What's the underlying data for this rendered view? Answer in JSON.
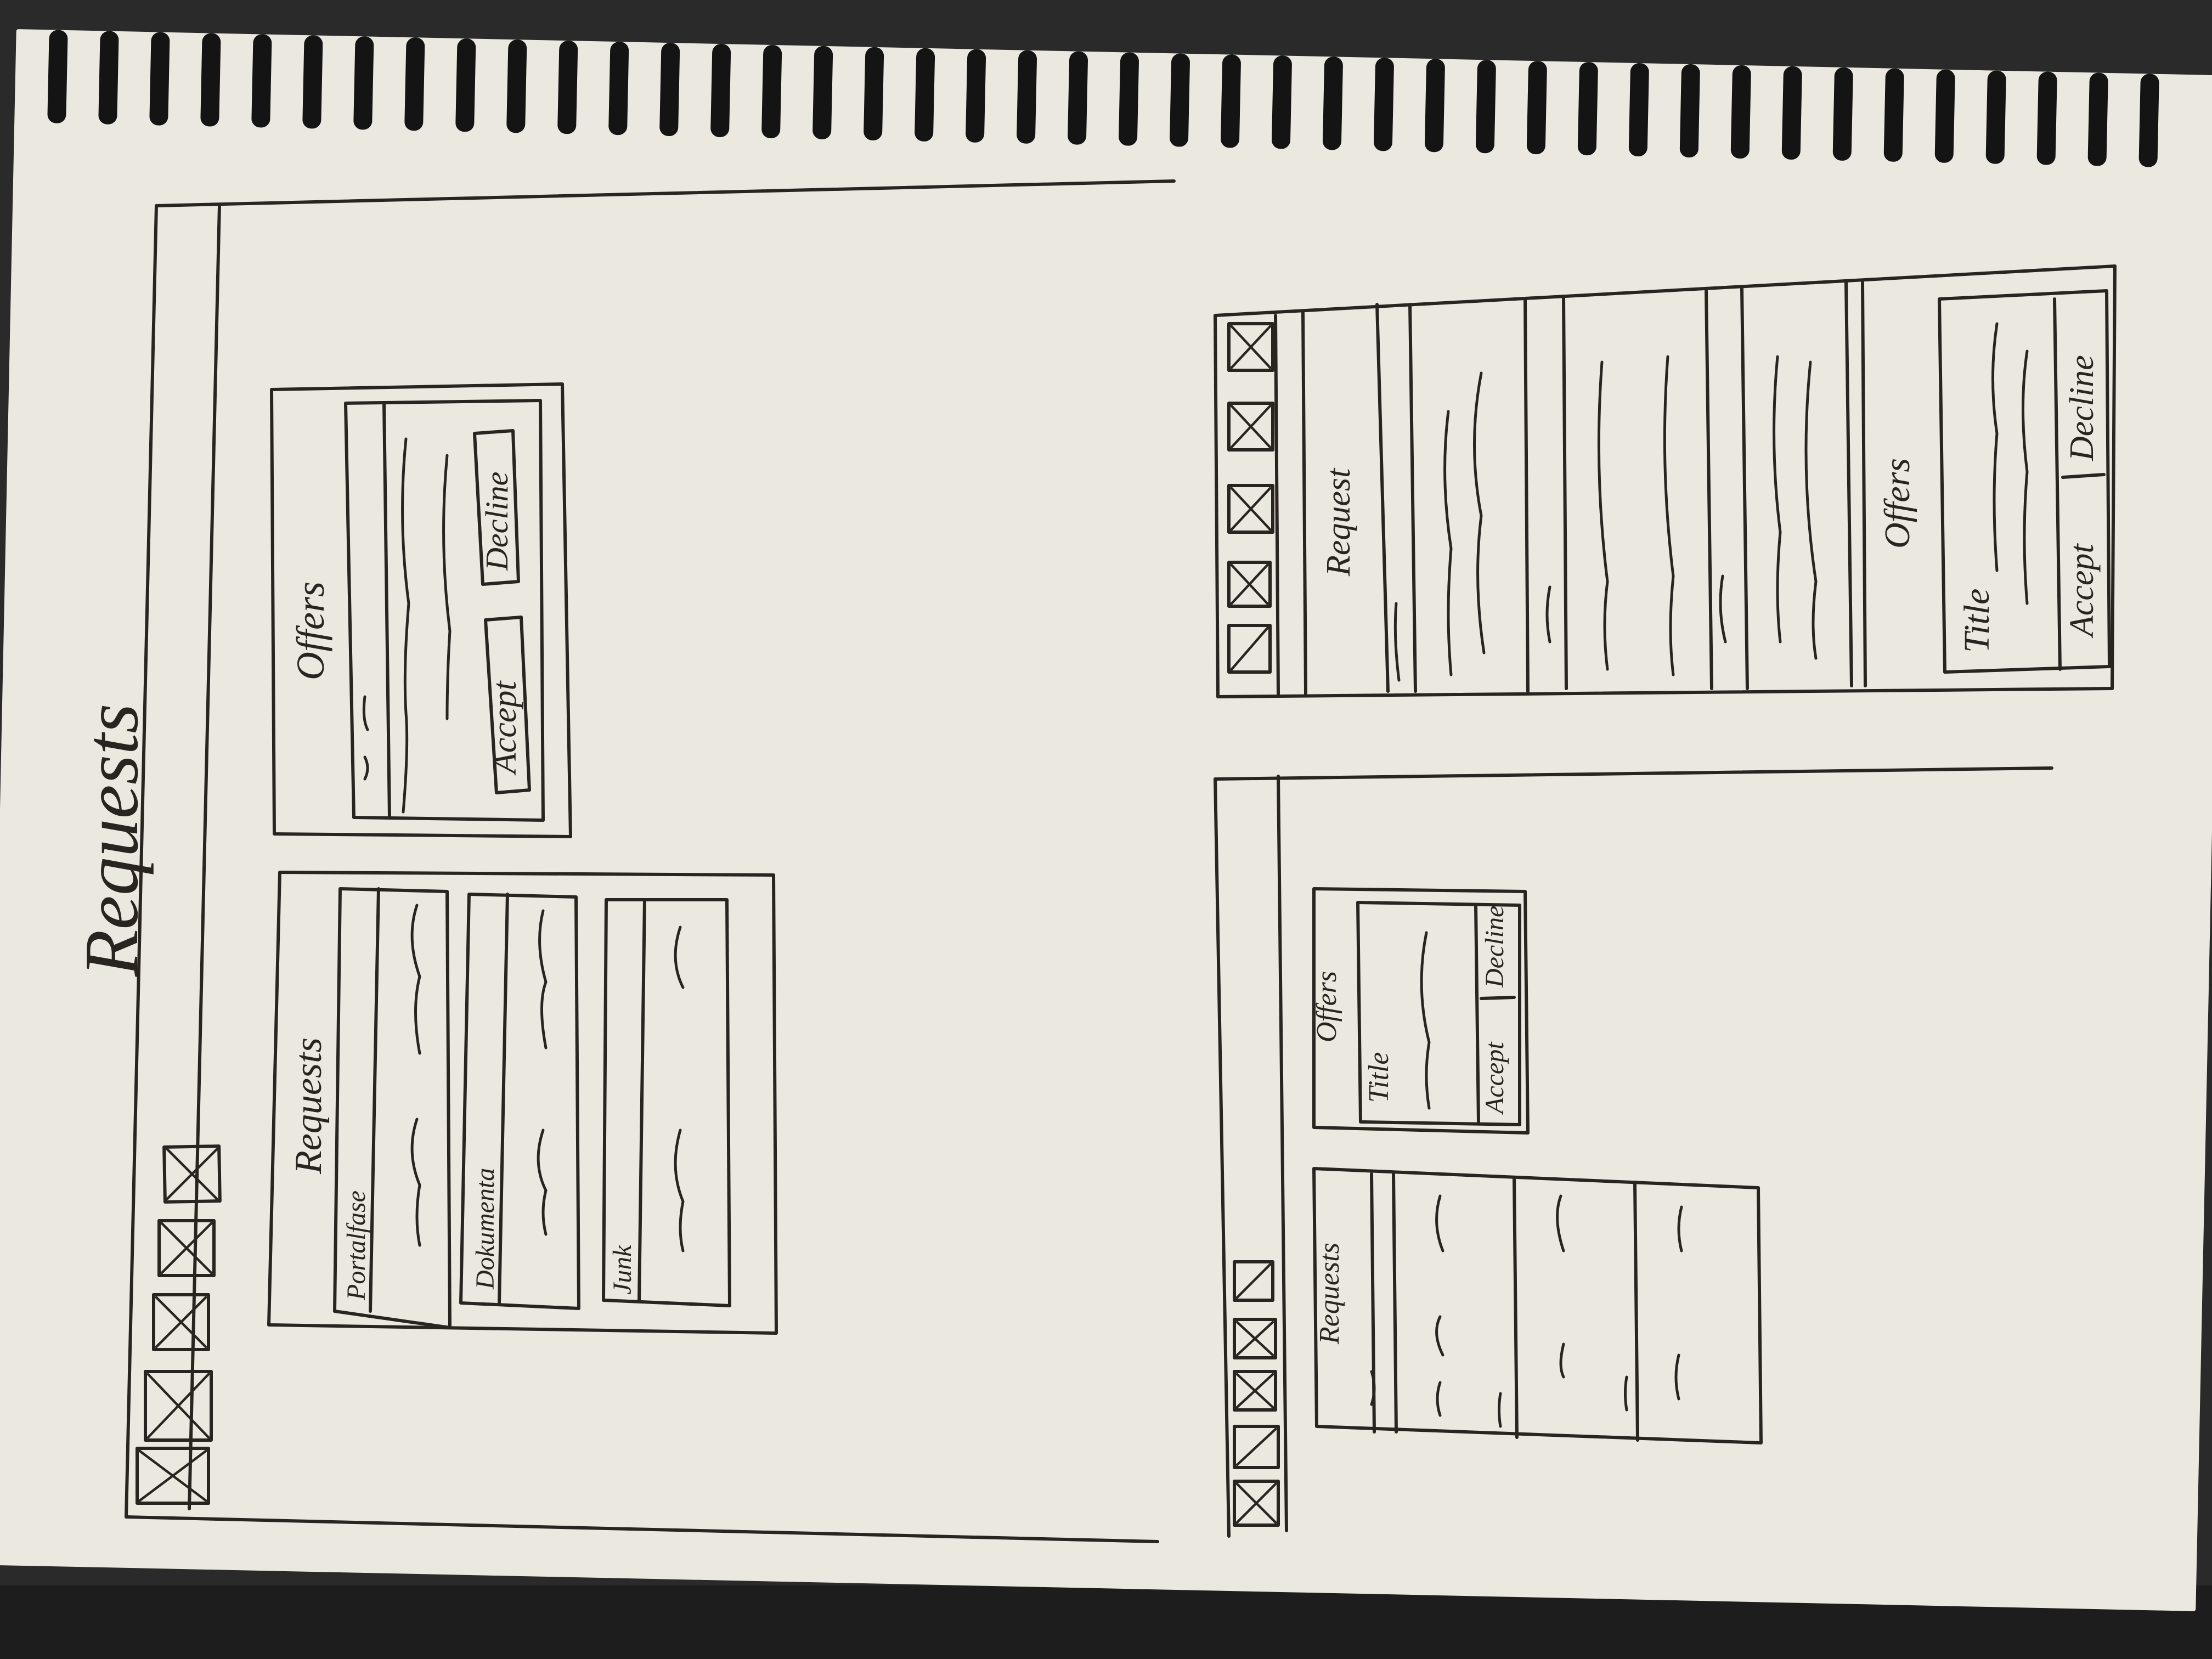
{
  "page_title": "Requests",
  "desktop_sketch": {
    "requests_panel": {
      "title": "Requests",
      "tabs": [
        "Portalfase",
        "Dokumenta",
        "Junk"
      ]
    },
    "offers_panel": {
      "title": "Offers",
      "accept_label": "Accept",
      "decline_label": "Decline"
    }
  },
  "tablet_sketch": {
    "requests_label": "Requests",
    "offers_panel": {
      "title": "Offers",
      "card_title": "Title",
      "accept_label": "Accept",
      "decline_label": "Decline"
    }
  },
  "phone_sketch": {
    "requests_label": "Request",
    "offers_panel": {
      "title": "Offers",
      "card_title": "Title",
      "accept_label": "Accept",
      "decline_label": "Decline"
    }
  }
}
